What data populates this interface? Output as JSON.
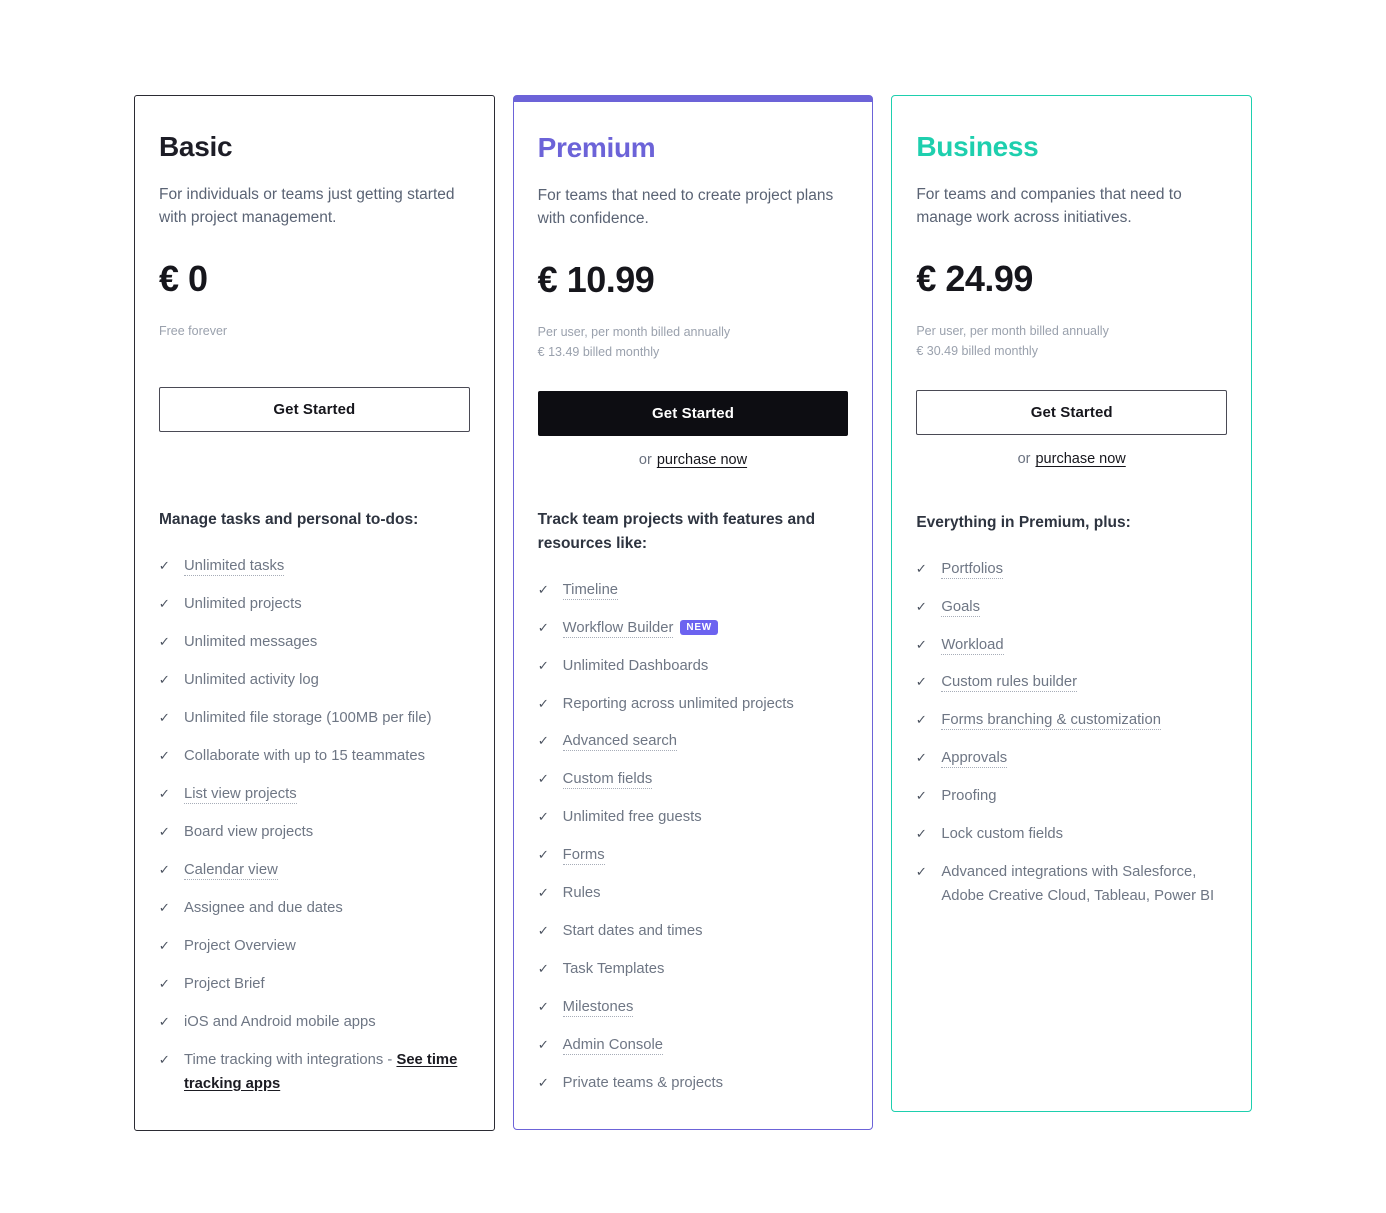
{
  "page": {
    "background": "#ffffff"
  },
  "colors": {
    "basic_accent": "#1d1d26",
    "premium_accent": "#6c63d8",
    "business_accent": "#1ecfae",
    "badge_new": "#6c63f0",
    "cta_filled_bg": "#0d0d12",
    "body_text": "#6e7684",
    "muted_text": "#9aa1ad"
  },
  "icons": {
    "check": "✓"
  },
  "plans": [
    {
      "id": "basic",
      "name": "Basic",
      "description": "For individuals or teams just getting started with project management.",
      "price": "€ 0",
      "billing_primary": "Free forever",
      "billing_secondary": "",
      "cta_label": "Get Started",
      "cta_style": "outline",
      "purchase_prefix": "",
      "purchase_link": "",
      "features_heading": "Manage tasks and personal to-dos:",
      "features": [
        {
          "label": "Unlimited tasks",
          "dotted": true,
          "badge": ""
        },
        {
          "label": "Unlimited projects",
          "dotted": false,
          "badge": ""
        },
        {
          "label": "Unlimited messages",
          "dotted": false,
          "badge": ""
        },
        {
          "label": "Unlimited activity log",
          "dotted": false,
          "badge": ""
        },
        {
          "label": "Unlimited file storage (100MB per file)",
          "dotted": false,
          "badge": ""
        },
        {
          "label": "Collaborate with up to 15 teammates",
          "dotted": false,
          "badge": ""
        },
        {
          "label": "List view projects",
          "dotted": true,
          "badge": ""
        },
        {
          "label": "Board view projects",
          "dotted": false,
          "badge": ""
        },
        {
          "label": "Calendar view",
          "dotted": true,
          "badge": ""
        },
        {
          "label": "Assignee and due dates",
          "dotted": false,
          "badge": ""
        },
        {
          "label": "Project Overview",
          "dotted": false,
          "badge": ""
        },
        {
          "label": "Project Brief",
          "dotted": false,
          "badge": ""
        },
        {
          "label": "iOS and Android mobile apps",
          "dotted": false,
          "badge": ""
        },
        {
          "label": "Time tracking with integrations - ",
          "dotted": false,
          "badge": "",
          "link_text": "See time tracking apps"
        }
      ]
    },
    {
      "id": "premium",
      "name": "Premium",
      "description": "For teams that need to create project plans with confidence.",
      "price": "€ 10.99",
      "billing_primary": "Per user, per month billed annually",
      "billing_secondary": "€ 13.49 billed monthly",
      "cta_label": "Get Started",
      "cta_style": "filled",
      "purchase_prefix": "or",
      "purchase_link": "purchase now",
      "features_heading": "Track team projects with features and resources like:",
      "features": [
        {
          "label": "Timeline",
          "dotted": true,
          "badge": ""
        },
        {
          "label": "Workflow Builder",
          "dotted": true,
          "badge": "NEW"
        },
        {
          "label": "Unlimited Dashboards",
          "dotted": false,
          "badge": ""
        },
        {
          "label": "Reporting across unlimited projects",
          "dotted": false,
          "badge": ""
        },
        {
          "label": "Advanced search",
          "dotted": true,
          "badge": ""
        },
        {
          "label": "Custom fields",
          "dotted": true,
          "badge": ""
        },
        {
          "label": "Unlimited free guests",
          "dotted": false,
          "badge": ""
        },
        {
          "label": "Forms",
          "dotted": true,
          "badge": ""
        },
        {
          "label": "Rules",
          "dotted": false,
          "badge": ""
        },
        {
          "label": "Start dates and times",
          "dotted": false,
          "badge": ""
        },
        {
          "label": "Task Templates",
          "dotted": false,
          "badge": ""
        },
        {
          "label": "Milestones",
          "dotted": true,
          "badge": ""
        },
        {
          "label": "Admin Console",
          "dotted": true,
          "badge": ""
        },
        {
          "label": "Private teams & projects",
          "dotted": false,
          "badge": ""
        }
      ]
    },
    {
      "id": "business",
      "name": "Business",
      "description": "For teams and companies that need to manage work across initiatives.",
      "price": "€ 24.99",
      "billing_primary": "Per user, per month billed annually",
      "billing_secondary": "€ 30.49 billed monthly",
      "cta_label": "Get Started",
      "cta_style": "outline",
      "purchase_prefix": "or",
      "purchase_link": "purchase now",
      "features_heading": "Everything in Premium, plus:",
      "features": [
        {
          "label": "Portfolios",
          "dotted": true,
          "badge": ""
        },
        {
          "label": "Goals",
          "dotted": true,
          "badge": ""
        },
        {
          "label": "Workload",
          "dotted": true,
          "badge": ""
        },
        {
          "label": "Custom rules builder",
          "dotted": true,
          "badge": ""
        },
        {
          "label": "Forms branching & customization",
          "dotted": true,
          "badge": ""
        },
        {
          "label": "Approvals",
          "dotted": true,
          "badge": ""
        },
        {
          "label": "Proofing",
          "dotted": false,
          "badge": ""
        },
        {
          "label": "Lock custom fields",
          "dotted": false,
          "badge": ""
        },
        {
          "label": "Advanced integrations with Salesforce, Adobe Creative Cloud, Tableau, Power BI",
          "dotted": false,
          "badge": ""
        }
      ]
    }
  ]
}
